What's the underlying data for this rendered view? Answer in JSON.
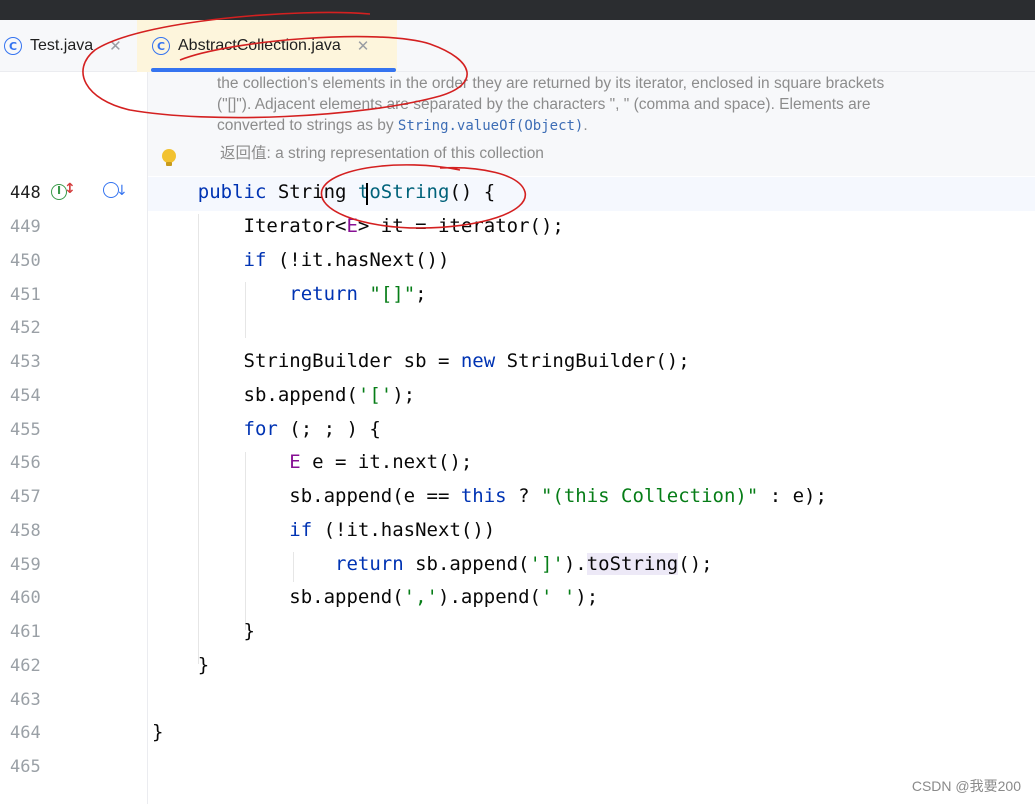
{
  "tabs": [
    {
      "label": "Test.java",
      "icon": "class-icon",
      "active": false
    },
    {
      "label": "AbstractCollection.java",
      "icon": "class-icon",
      "active": true
    }
  ],
  "doc": {
    "line1": "the collection's elements in the order they are returned by its iterator, enclosed in square brackets",
    "line2": "(\"[]\"). Adjacent elements are separated by the characters \", \" (comma and space). Elements are",
    "line3_pre": "converted to strings as by ",
    "line3_code": "String.valueOf(Object)",
    "line3_post": ".",
    "returns_label": "返回值:",
    "returns_text": " a string representation of this collection"
  },
  "line_numbers": [
    "448",
    "449",
    "450",
    "451",
    "452",
    "453",
    "454",
    "455",
    "456",
    "457",
    "458",
    "459",
    "460",
    "461",
    "462",
    "463",
    "464",
    "465"
  ],
  "current_line": "448",
  "watermark": "CSDN @我要200",
  "colors": {
    "keyword": "#0033b3",
    "string": "#067d17",
    "type_param": "#871094",
    "method": "#00627a",
    "annotation_ink": "#d42020",
    "tab_accent": "#3574f0"
  }
}
